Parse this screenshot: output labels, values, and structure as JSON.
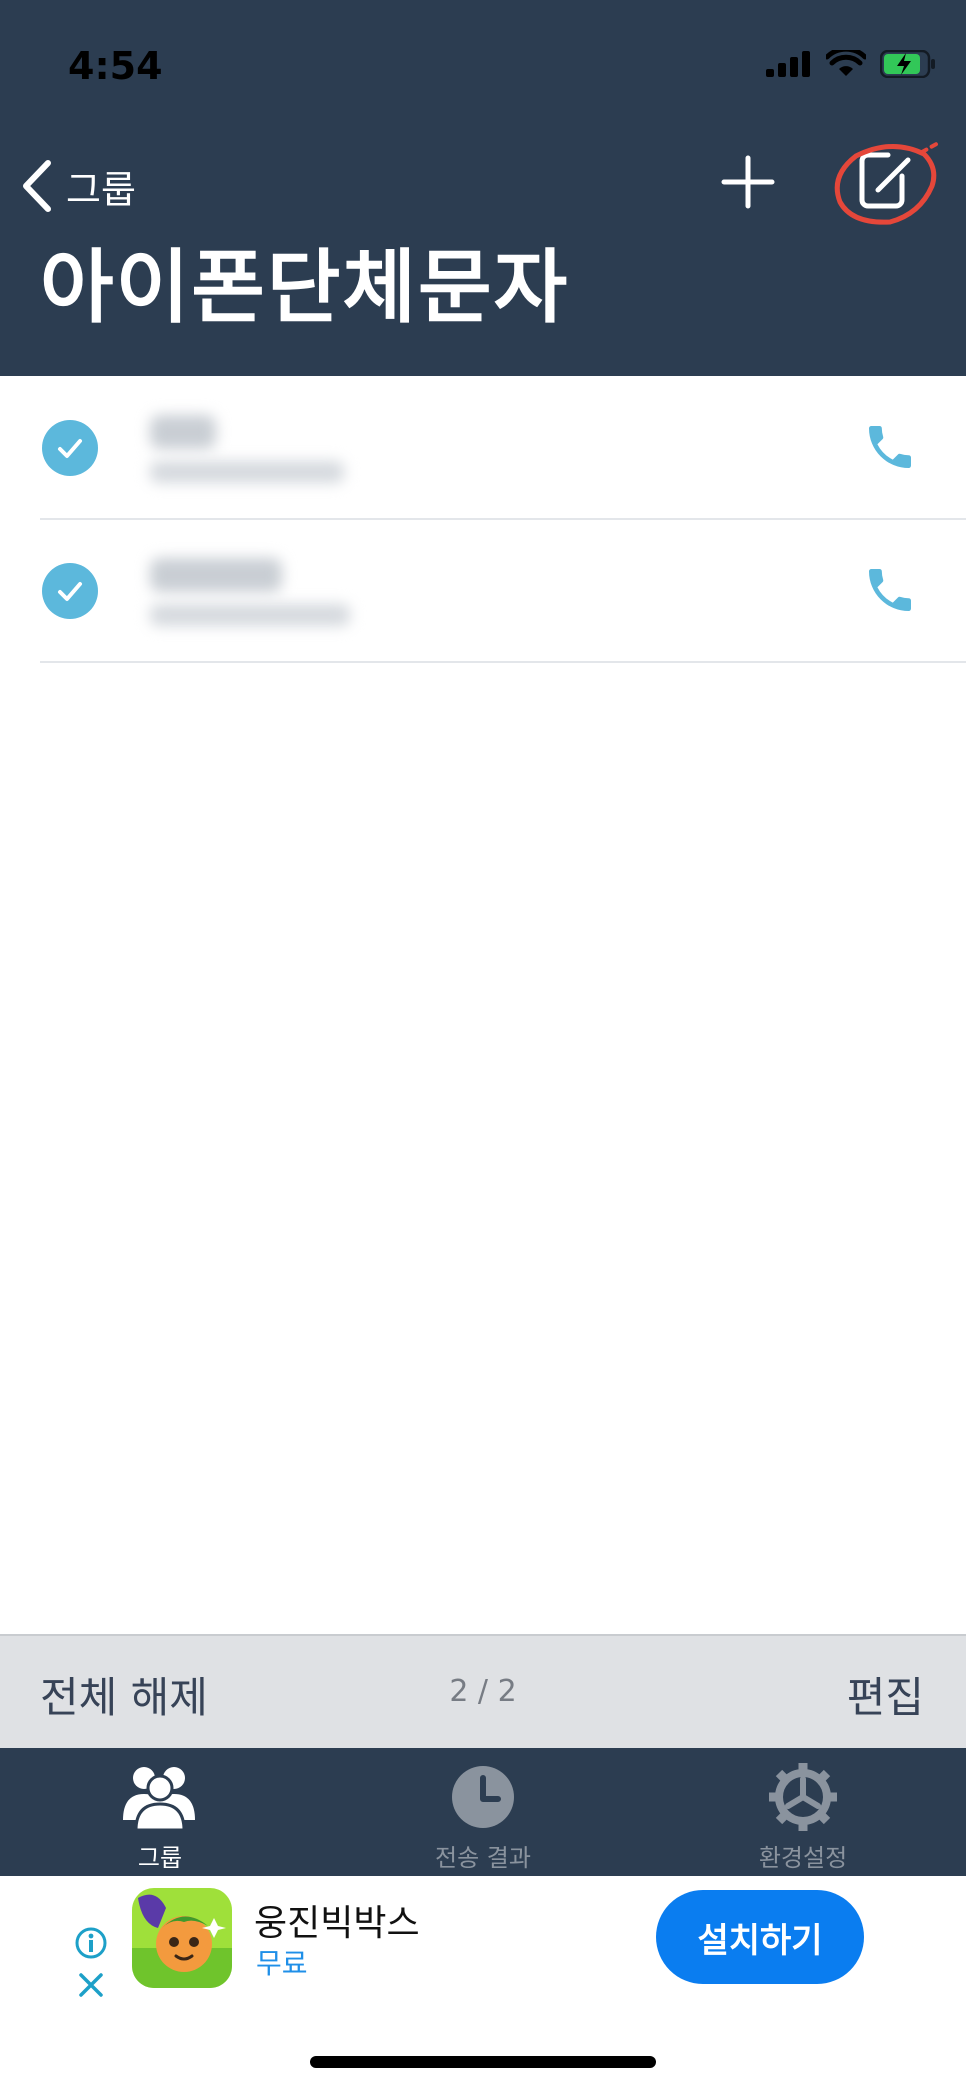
{
  "status": {
    "time": "4:54"
  },
  "nav": {
    "back_label": "그룹",
    "title": "아이폰단체문자"
  },
  "contacts": [
    {
      "checked": true
    },
    {
      "checked": true
    }
  ],
  "toolbar": {
    "deselect_all": "전체 해제",
    "count": "2 / 2",
    "edit": "편집"
  },
  "tabs": [
    {
      "label": "그룹",
      "icon": "group-icon",
      "active": true
    },
    {
      "label": "전송 결과",
      "icon": "clock-icon",
      "active": false
    },
    {
      "label": "환경설정",
      "icon": "gear-icon",
      "active": false
    }
  ],
  "ad": {
    "app_name": "웅진빅박스",
    "price": "무료",
    "install": "설치하기"
  },
  "colors": {
    "header": "#2c3d51",
    "accent": "#5cb8dc",
    "install": "#0a7df0",
    "tab_active": "#ffffff",
    "tab_inactive": "#8a939e"
  }
}
